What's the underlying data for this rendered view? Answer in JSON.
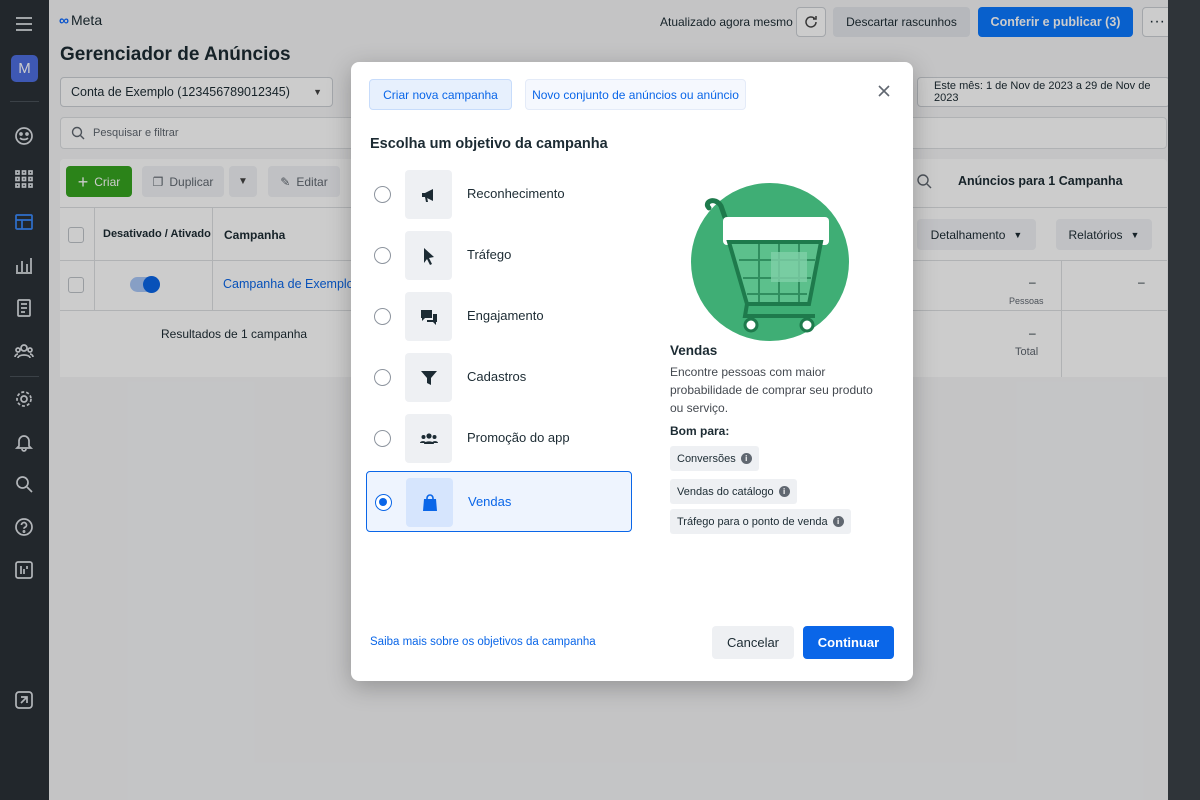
{
  "brand": {
    "logo_text": "Meta"
  },
  "header": {
    "title": "Gerenciador de Anúncios",
    "updated_text": "Atualizado agora mesmo",
    "discard_label": "Descartar rascunhos",
    "publish_label": "Conferir e publicar (3)",
    "more_label": "···"
  },
  "account": {
    "selected": "Conta de Exemplo (123456789012345)"
  },
  "date_range": "Este mês: 1 de Nov de 2023 a 29 de Nov de 2023",
  "search": {
    "placeholder": "Pesquisar e filtrar"
  },
  "toolbar": {
    "create_label": "Criar",
    "duplicate_label": "Duplicar",
    "edit_label": "Editar",
    "ads_for_label": "Anúncios para 1 Campanha"
  },
  "table": {
    "col_toggle": "Desativado / Ativado",
    "col_campaign": "Campanha",
    "breakdown_label": "Detalhamento",
    "reports_label": "Relatórios",
    "row": {
      "campaign": "Campanha de Exemplo",
      "metric_a": "–",
      "metric_a_sub": "Pessoas",
      "metric_b": "–"
    },
    "summary": {
      "results": "Resultados de 1 campanha",
      "metric_a": "–",
      "metric_a_sub": "Total"
    }
  },
  "modal": {
    "tab_new_campaign": "Criar nova campanha",
    "tab_new_adset": "Novo conjunto de anúncios ou anúncio",
    "heading": "Escolha um objetivo da campanha",
    "options": [
      {
        "label": "Reconhecimento",
        "icon": "megaphone-icon",
        "selected": false
      },
      {
        "label": "Tráfego",
        "icon": "cursor-icon",
        "selected": false
      },
      {
        "label": "Engajamento",
        "icon": "chat-icon",
        "selected": false
      },
      {
        "label": "Cadastros",
        "icon": "filter-icon",
        "selected": false
      },
      {
        "label": "Promoção do app",
        "icon": "people-icon",
        "selected": false
      },
      {
        "label": "Vendas",
        "icon": "shopping-bag-icon",
        "selected": true
      }
    ],
    "detail": {
      "title": "Vendas",
      "description": "Encontre pessoas com maior probabilidade de comprar seu produto ou serviço.",
      "good_for_label": "Bom para:",
      "chips": [
        "Conversões",
        "Vendas do catálogo",
        "Tráfego para o ponto de venda"
      ]
    },
    "learn_more": "Saiba mais sobre os objetivos da campanha",
    "cancel_label": "Cancelar",
    "continue_label": "Continuar"
  },
  "colors": {
    "primary": "#0a66e8",
    "create_green": "#36a420",
    "illustration_green": "#3fae75"
  }
}
